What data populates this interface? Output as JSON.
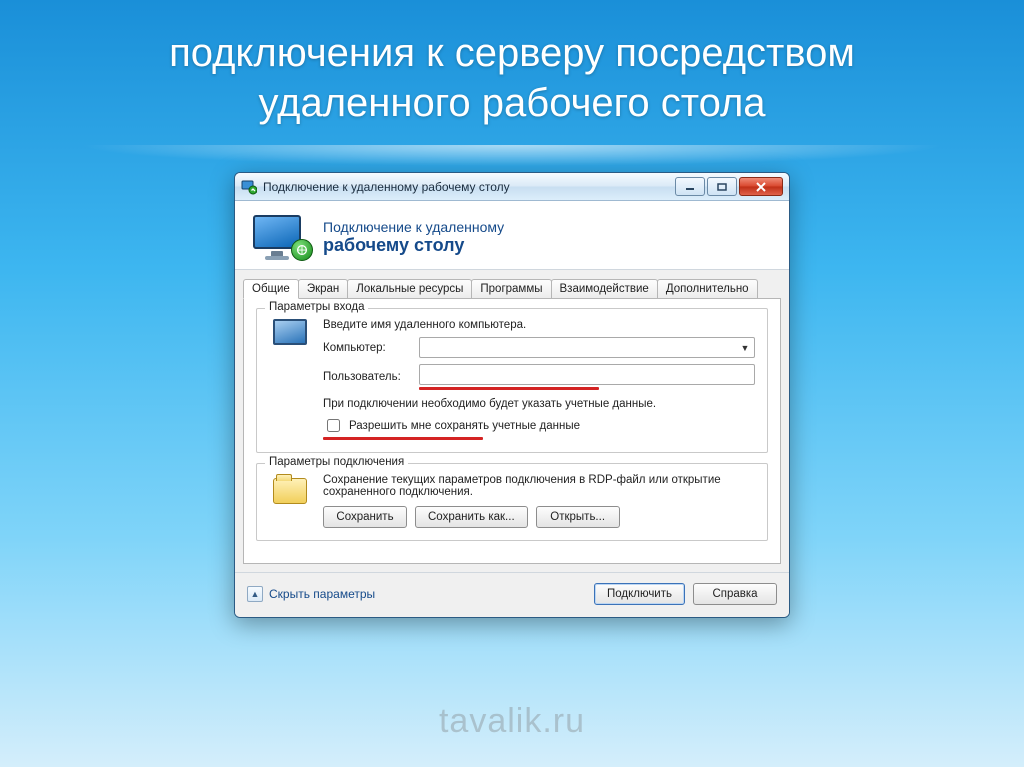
{
  "slide": {
    "title": "подключения к серверу посредством удаленного рабочего стола"
  },
  "win": {
    "title": "Подключение к удаленному рабочему столу",
    "header": {
      "line1": "Подключение к удаленному",
      "line2": "рабочему столу"
    },
    "tabs": [
      "Общие",
      "Экран",
      "Локальные ресурсы",
      "Программы",
      "Взаимодействие",
      "Дополнительно"
    ],
    "active_tab_index": 0,
    "login_group": {
      "legend": "Параметры входа",
      "instruction": "Введите имя удаленного компьютера.",
      "computer_label": "Компьютер:",
      "computer_value": "",
      "user_label": "Пользователь:",
      "user_value": "",
      "hint": "При подключении необходимо будет указать учетные данные.",
      "save_creds_label": "Разрешить мне сохранять учетные данные",
      "save_creds_checked": false
    },
    "conn_group": {
      "legend": "Параметры подключения",
      "description": "Сохранение текущих параметров подключения в RDP-файл или открытие сохраненного подключения.",
      "save_btn": "Сохранить",
      "save_as_btn": "Сохранить как...",
      "open_btn": "Открыть..."
    },
    "footer": {
      "hide_params": "Скрыть параметры",
      "connect_btn": "Подключить",
      "help_btn": "Справка"
    }
  },
  "watermark": "tavalik.ru"
}
